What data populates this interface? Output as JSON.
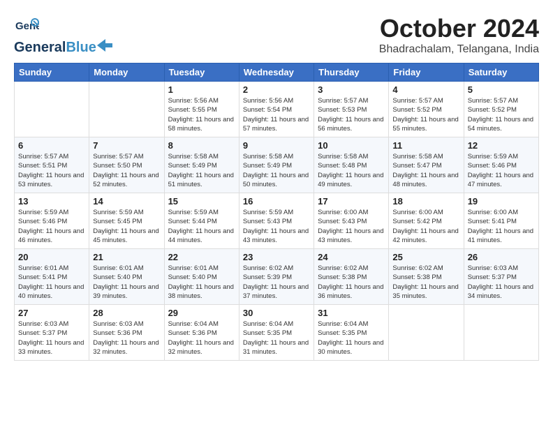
{
  "header": {
    "logo_general": "General",
    "logo_blue": "Blue",
    "month_title": "October 2024",
    "location": "Bhadrachalam, Telangana, India"
  },
  "weekdays": [
    "Sunday",
    "Monday",
    "Tuesday",
    "Wednesday",
    "Thursday",
    "Friday",
    "Saturday"
  ],
  "weeks": [
    [
      {
        "day": "",
        "info": ""
      },
      {
        "day": "",
        "info": ""
      },
      {
        "day": "1",
        "info": "Sunrise: 5:56 AM\nSunset: 5:55 PM\nDaylight: 11 hours and 58 minutes."
      },
      {
        "day": "2",
        "info": "Sunrise: 5:56 AM\nSunset: 5:54 PM\nDaylight: 11 hours and 57 minutes."
      },
      {
        "day": "3",
        "info": "Sunrise: 5:57 AM\nSunset: 5:53 PM\nDaylight: 11 hours and 56 minutes."
      },
      {
        "day": "4",
        "info": "Sunrise: 5:57 AM\nSunset: 5:52 PM\nDaylight: 11 hours and 55 minutes."
      },
      {
        "day": "5",
        "info": "Sunrise: 5:57 AM\nSunset: 5:52 PM\nDaylight: 11 hours and 54 minutes."
      }
    ],
    [
      {
        "day": "6",
        "info": "Sunrise: 5:57 AM\nSunset: 5:51 PM\nDaylight: 11 hours and 53 minutes."
      },
      {
        "day": "7",
        "info": "Sunrise: 5:57 AM\nSunset: 5:50 PM\nDaylight: 11 hours and 52 minutes."
      },
      {
        "day": "8",
        "info": "Sunrise: 5:58 AM\nSunset: 5:49 PM\nDaylight: 11 hours and 51 minutes."
      },
      {
        "day": "9",
        "info": "Sunrise: 5:58 AM\nSunset: 5:49 PM\nDaylight: 11 hours and 50 minutes."
      },
      {
        "day": "10",
        "info": "Sunrise: 5:58 AM\nSunset: 5:48 PM\nDaylight: 11 hours and 49 minutes."
      },
      {
        "day": "11",
        "info": "Sunrise: 5:58 AM\nSunset: 5:47 PM\nDaylight: 11 hours and 48 minutes."
      },
      {
        "day": "12",
        "info": "Sunrise: 5:59 AM\nSunset: 5:46 PM\nDaylight: 11 hours and 47 minutes."
      }
    ],
    [
      {
        "day": "13",
        "info": "Sunrise: 5:59 AM\nSunset: 5:46 PM\nDaylight: 11 hours and 46 minutes."
      },
      {
        "day": "14",
        "info": "Sunrise: 5:59 AM\nSunset: 5:45 PM\nDaylight: 11 hours and 45 minutes."
      },
      {
        "day": "15",
        "info": "Sunrise: 5:59 AM\nSunset: 5:44 PM\nDaylight: 11 hours and 44 minutes."
      },
      {
        "day": "16",
        "info": "Sunrise: 5:59 AM\nSunset: 5:43 PM\nDaylight: 11 hours and 43 minutes."
      },
      {
        "day": "17",
        "info": "Sunrise: 6:00 AM\nSunset: 5:43 PM\nDaylight: 11 hours and 43 minutes."
      },
      {
        "day": "18",
        "info": "Sunrise: 6:00 AM\nSunset: 5:42 PM\nDaylight: 11 hours and 42 minutes."
      },
      {
        "day": "19",
        "info": "Sunrise: 6:00 AM\nSunset: 5:41 PM\nDaylight: 11 hours and 41 minutes."
      }
    ],
    [
      {
        "day": "20",
        "info": "Sunrise: 6:01 AM\nSunset: 5:41 PM\nDaylight: 11 hours and 40 minutes."
      },
      {
        "day": "21",
        "info": "Sunrise: 6:01 AM\nSunset: 5:40 PM\nDaylight: 11 hours and 39 minutes."
      },
      {
        "day": "22",
        "info": "Sunrise: 6:01 AM\nSunset: 5:40 PM\nDaylight: 11 hours and 38 minutes."
      },
      {
        "day": "23",
        "info": "Sunrise: 6:02 AM\nSunset: 5:39 PM\nDaylight: 11 hours and 37 minutes."
      },
      {
        "day": "24",
        "info": "Sunrise: 6:02 AM\nSunset: 5:38 PM\nDaylight: 11 hours and 36 minutes."
      },
      {
        "day": "25",
        "info": "Sunrise: 6:02 AM\nSunset: 5:38 PM\nDaylight: 11 hours and 35 minutes."
      },
      {
        "day": "26",
        "info": "Sunrise: 6:03 AM\nSunset: 5:37 PM\nDaylight: 11 hours and 34 minutes."
      }
    ],
    [
      {
        "day": "27",
        "info": "Sunrise: 6:03 AM\nSunset: 5:37 PM\nDaylight: 11 hours and 33 minutes."
      },
      {
        "day": "28",
        "info": "Sunrise: 6:03 AM\nSunset: 5:36 PM\nDaylight: 11 hours and 32 minutes."
      },
      {
        "day": "29",
        "info": "Sunrise: 6:04 AM\nSunset: 5:36 PM\nDaylight: 11 hours and 32 minutes."
      },
      {
        "day": "30",
        "info": "Sunrise: 6:04 AM\nSunset: 5:35 PM\nDaylight: 11 hours and 31 minutes."
      },
      {
        "day": "31",
        "info": "Sunrise: 6:04 AM\nSunset: 5:35 PM\nDaylight: 11 hours and 30 minutes."
      },
      {
        "day": "",
        "info": ""
      },
      {
        "day": "",
        "info": ""
      }
    ]
  ]
}
